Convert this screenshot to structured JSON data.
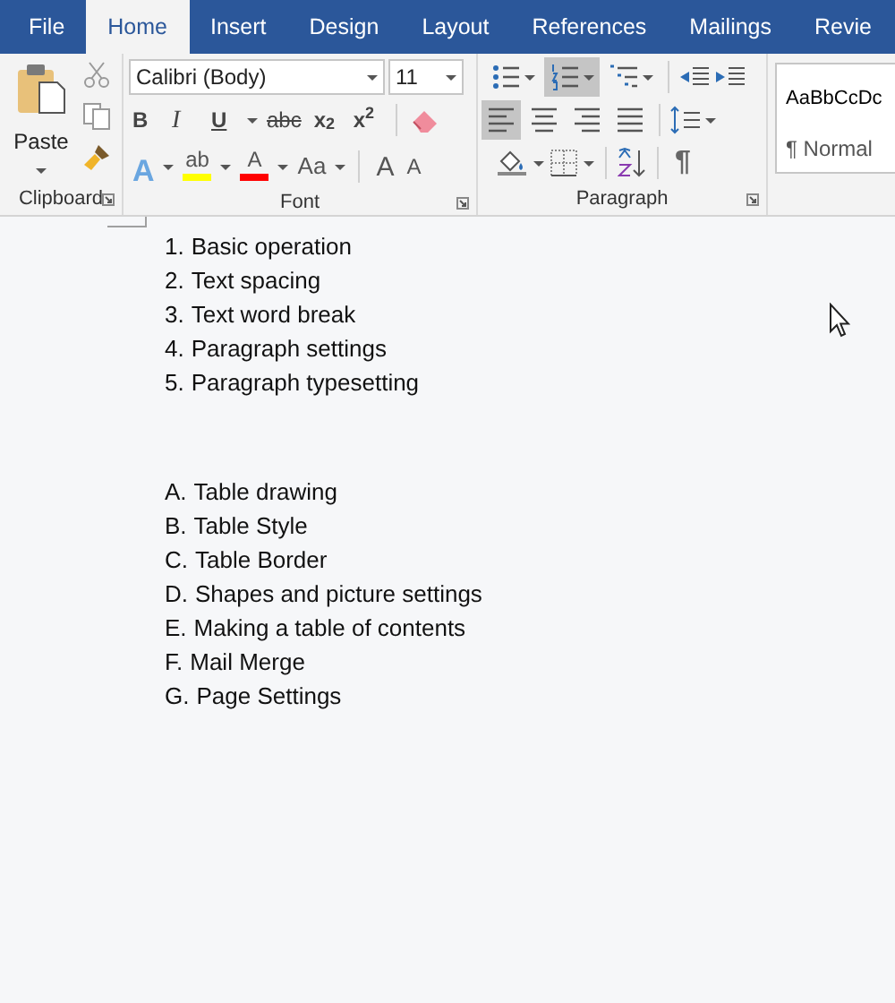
{
  "tabs": [
    {
      "label": "File",
      "selected": false
    },
    {
      "label": "Home",
      "selected": true
    },
    {
      "label": "Insert",
      "selected": false
    },
    {
      "label": "Design",
      "selected": false
    },
    {
      "label": "Layout",
      "selected": false
    },
    {
      "label": "References",
      "selected": false
    },
    {
      "label": "Mailings",
      "selected": false
    },
    {
      "label": "Revie",
      "selected": false
    }
  ],
  "clipboard": {
    "paste_label": "Paste",
    "group_label": "Clipboard"
  },
  "font": {
    "font_name": "Calibri (Body)",
    "font_size": "11",
    "group_label": "Font",
    "format_buttons": [
      {
        "kind": "bold",
        "label": "B"
      },
      {
        "kind": "italic",
        "label": "I"
      },
      {
        "kind": "underline",
        "label": "U"
      },
      {
        "kind": "strike",
        "label": "abc"
      },
      {
        "kind": "subscript",
        "label": "x$_{2}$"
      },
      {
        "kind": "superscript",
        "label": "x$^{2}$"
      }
    ],
    "effect_buttons": [
      {
        "kind": "effects",
        "label": "A"
      },
      {
        "kind": "highlight",
        "label": "ab",
        "color": "#ffff00"
      },
      {
        "kind": "color",
        "label": "A",
        "color": "#ff0000"
      },
      {
        "kind": "case",
        "label": "Aa"
      }
    ],
    "size_buttons": [
      {
        "kind": "grow",
        "label": "A"
      },
      {
        "kind": "shrink",
        "label": "A"
      }
    ]
  },
  "paragraph": {
    "group_label": "Paragraph",
    "list_buttons": [
      {
        "kind": "bullets",
        "selected": false
      },
      {
        "kind": "numbering",
        "selected": true
      },
      {
        "kind": "multilevel",
        "selected": false
      }
    ],
    "align_buttons": [
      {
        "kind": "left",
        "selected": true
      },
      {
        "kind": "center",
        "selected": false
      },
      {
        "kind": "right",
        "selected": false
      },
      {
        "kind": "justify",
        "selected": false
      }
    ],
    "show_marks_label": "¶"
  },
  "styles": {
    "preview": "AaBbCcDc",
    "style_name": "¶ Normal"
  },
  "document": {
    "lists": [
      {
        "items": [
          {
            "marker": "1.",
            "text": "Basic operation"
          },
          {
            "marker": "2.",
            "text": "Text spacing"
          },
          {
            "marker": "3.",
            "text": "Text word break"
          },
          {
            "marker": "4.",
            "text": "Paragraph settings"
          },
          {
            "marker": "5.",
            "text": "Paragraph typesetting"
          }
        ]
      },
      {
        "items": [
          {
            "marker": "A.",
            "text": "Table drawing"
          },
          {
            "marker": "B.",
            "text": "Table Style"
          },
          {
            "marker": "C.",
            "text": "Table Border"
          },
          {
            "marker": "D.",
            "text": "Shapes and picture settings"
          },
          {
            "marker": "E.",
            "text": "Making a table of contents"
          },
          {
            "marker": "F.",
            "text": "Mail Merge"
          },
          {
            "marker": "G.",
            "text": "Page Settings"
          }
        ]
      }
    ]
  }
}
